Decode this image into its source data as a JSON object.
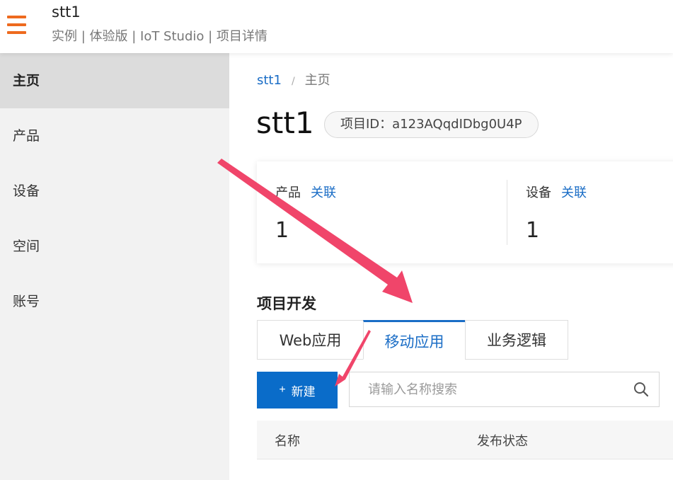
{
  "header": {
    "title": "stt1",
    "subtitle": "实例 | 体验版 | IoT Studio | 项目详情"
  },
  "sidebar": {
    "items": [
      {
        "label": "主页",
        "active": true
      },
      {
        "label": "产品",
        "active": false
      },
      {
        "label": "设备",
        "active": false
      },
      {
        "label": "空间",
        "active": false
      },
      {
        "label": "账号",
        "active": false
      }
    ]
  },
  "breadcrumb": {
    "root": "stt1",
    "separator": "/",
    "current": "主页"
  },
  "project": {
    "title": "stt1",
    "id_badge": "项目ID：a123AQqdIDbg0U4P"
  },
  "stats": [
    {
      "label": "产品",
      "link": "关联",
      "value": "1"
    },
    {
      "label": "设备",
      "link": "关联",
      "value": "1"
    }
  ],
  "development": {
    "title": "项目开发",
    "tabs": [
      {
        "label": "Web应用",
        "active": false
      },
      {
        "label": "移动应用",
        "active": true
      },
      {
        "label": "业务逻辑",
        "active": false
      }
    ],
    "new_button": "新建",
    "search_placeholder": "请输入名称搜索",
    "table_columns": [
      "名称",
      "发布状态"
    ]
  },
  "colors": {
    "accent": "#1a6dc6",
    "primary_button": "#0a6cc9",
    "menu_icon": "#ee6a1e",
    "annotation_arrow": "#f0456a"
  }
}
